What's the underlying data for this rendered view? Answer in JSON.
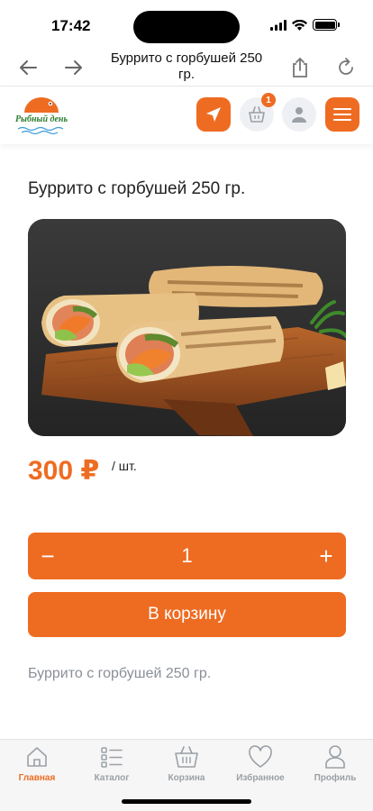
{
  "status_bar": {
    "time": "17:42"
  },
  "browser": {
    "title": "Буррито с горбушей 250 гр."
  },
  "header": {
    "logo_text": "Рыбный день",
    "cart_count": "1"
  },
  "product": {
    "title": "Буррито с горбушей 250 гр.",
    "price": "300 ₽",
    "price_unit": "/ шт.",
    "quantity": "1",
    "minus_label": "−",
    "plus_label": "+",
    "add_to_cart_label": "В корзину",
    "description": "Буррито с горбушей 250 гр.",
    "image_icon": "burrito-photo"
  },
  "tabs": [
    {
      "label": "Главная",
      "icon": "home-icon",
      "active": true
    },
    {
      "label": "Каталог",
      "icon": "catalog-icon",
      "active": false
    },
    {
      "label": "Корзина",
      "icon": "basket-icon",
      "active": false
    },
    {
      "label": "Избранное",
      "icon": "heart-icon",
      "active": false
    },
    {
      "label": "Профиль",
      "icon": "profile-icon",
      "active": false
    }
  ],
  "colors": {
    "accent": "#ee6c22",
    "inactive": "#9aa0a6",
    "logo_green": "#2e7d32"
  }
}
